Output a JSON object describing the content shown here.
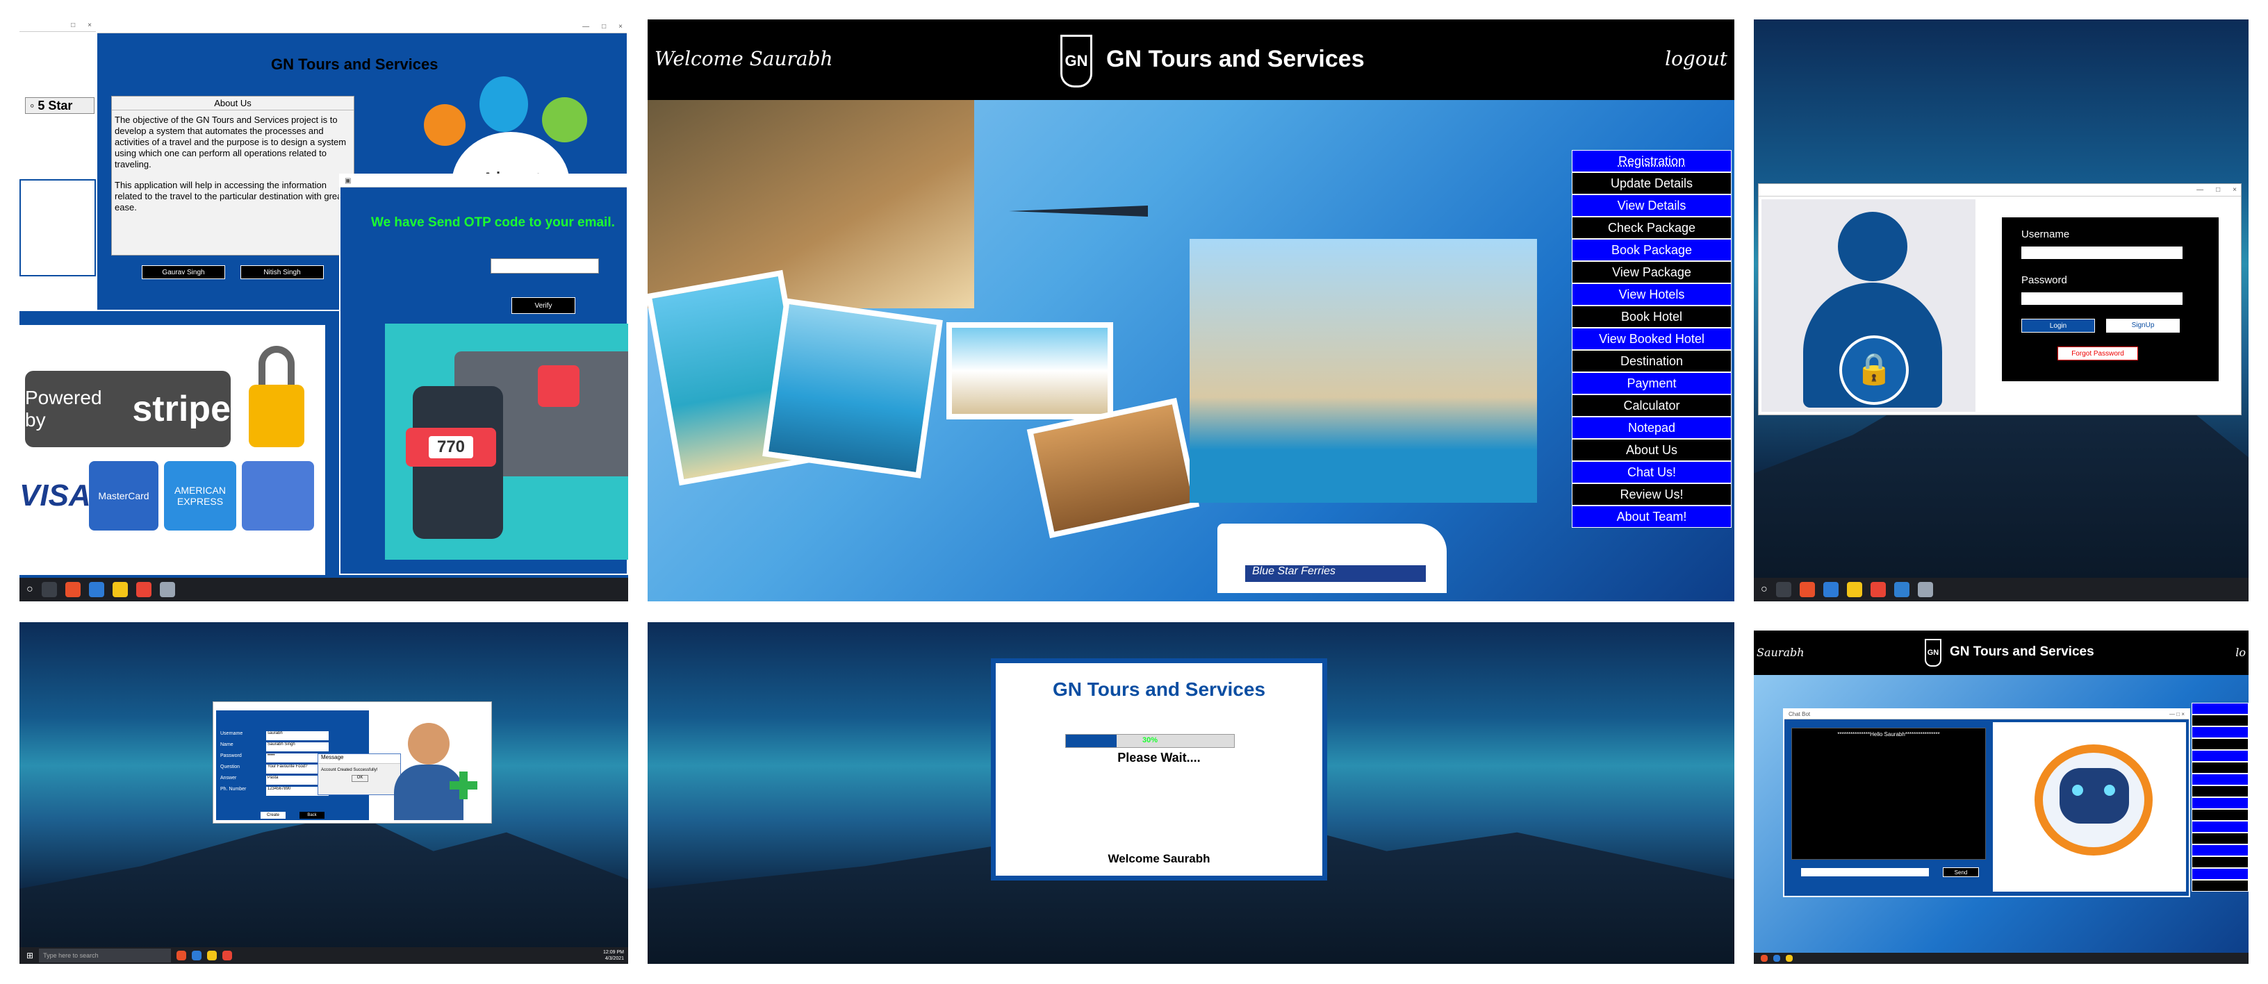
{
  "panel1": {
    "app_title": "GN Tours and Services",
    "rating": "5 Star",
    "about_title": "About Us",
    "about_text_1": "The objective of the GN Tours and Services project is to develop a system that automates the processes and activities of a travel and the purpose is to design a system using which one can perform all operations related to traveling.",
    "about_text_2": "This application will help in accessing the information related to the travel to the particular destination with great ease.",
    "about_heading": "About",
    "member_1": "Gaurav Singh",
    "member_2": "Nitish Singh",
    "otp_message": "We have Send OTP code to your email.",
    "verify_label": "Verify",
    "otp_code": "770",
    "powered_by": "Powered by",
    "stripe": "stripe",
    "visa": "VISA",
    "mastercard": "MasterCard",
    "amex": "AMERICAN EXPRESS"
  },
  "panel2": {
    "welcome": "Welcome Saurabh",
    "logo": "GN",
    "title": "GN Tours and Services",
    "logout": "logout",
    "menu": [
      {
        "label": "Registration",
        "style": "blue"
      },
      {
        "label": "Update Details",
        "style": "black"
      },
      {
        "label": "View Details",
        "style": "blue"
      },
      {
        "label": "Check Package",
        "style": "black"
      },
      {
        "label": "Book Package",
        "style": "blue"
      },
      {
        "label": "View Package",
        "style": "black"
      },
      {
        "label": "View Hotels",
        "style": "blue"
      },
      {
        "label": "Book Hotel",
        "style": "black"
      },
      {
        "label": "View Booked Hotel",
        "style": "blue"
      },
      {
        "label": "Destination",
        "style": "black"
      },
      {
        "label": "Payment",
        "style": "blue"
      },
      {
        "label": "Calculator",
        "style": "black"
      },
      {
        "label": "Notepad",
        "style": "blue"
      },
      {
        "label": "About Us",
        "style": "black"
      },
      {
        "label": "Chat Us!",
        "style": "blue"
      },
      {
        "label": "Review Us!",
        "style": "black"
      },
      {
        "label": "About Team!",
        "style": "blue"
      }
    ],
    "ship_label": "Blue Star Ferries"
  },
  "panel3": {
    "username_label": "Username",
    "password_label": "Password",
    "login": "Login",
    "signup": "SignUp",
    "forgot": "Forgot Password"
  },
  "panel4": {
    "fields": [
      "Username",
      "Name",
      "Password",
      "Question",
      "Answer",
      "Ph. Number"
    ],
    "values": [
      "saurabh",
      "Saurabh Singh",
      "•••••",
      "Your Favourite Food?",
      "Pasta",
      "1234567890"
    ],
    "dialog_title": "Message",
    "dialog_text": "Account Created Successfully!",
    "ok": "OK",
    "create": "Create",
    "back": "Back",
    "search_placeholder": "Type here to search",
    "time": "12:09 PM",
    "date": "4/3/2021"
  },
  "panel5": {
    "title": "GN Tours and Services",
    "progress_text": "30%",
    "progress_value": 0.3,
    "wait": "Please Wait....",
    "welcome": "Welcome Saurabh"
  },
  "panel6": {
    "user": "Saurabh",
    "logo": "GN",
    "title": "GN Tours and Services",
    "logout_partial": "lo",
    "chat_title": "Chat Bot",
    "chat_greeting": "***************Hello Saurabh****************",
    "send": "Send"
  },
  "colors": {
    "app_blue": "#0b4ea2",
    "menu_blue": "#0000ff",
    "bright_green": "#1bff2f"
  }
}
